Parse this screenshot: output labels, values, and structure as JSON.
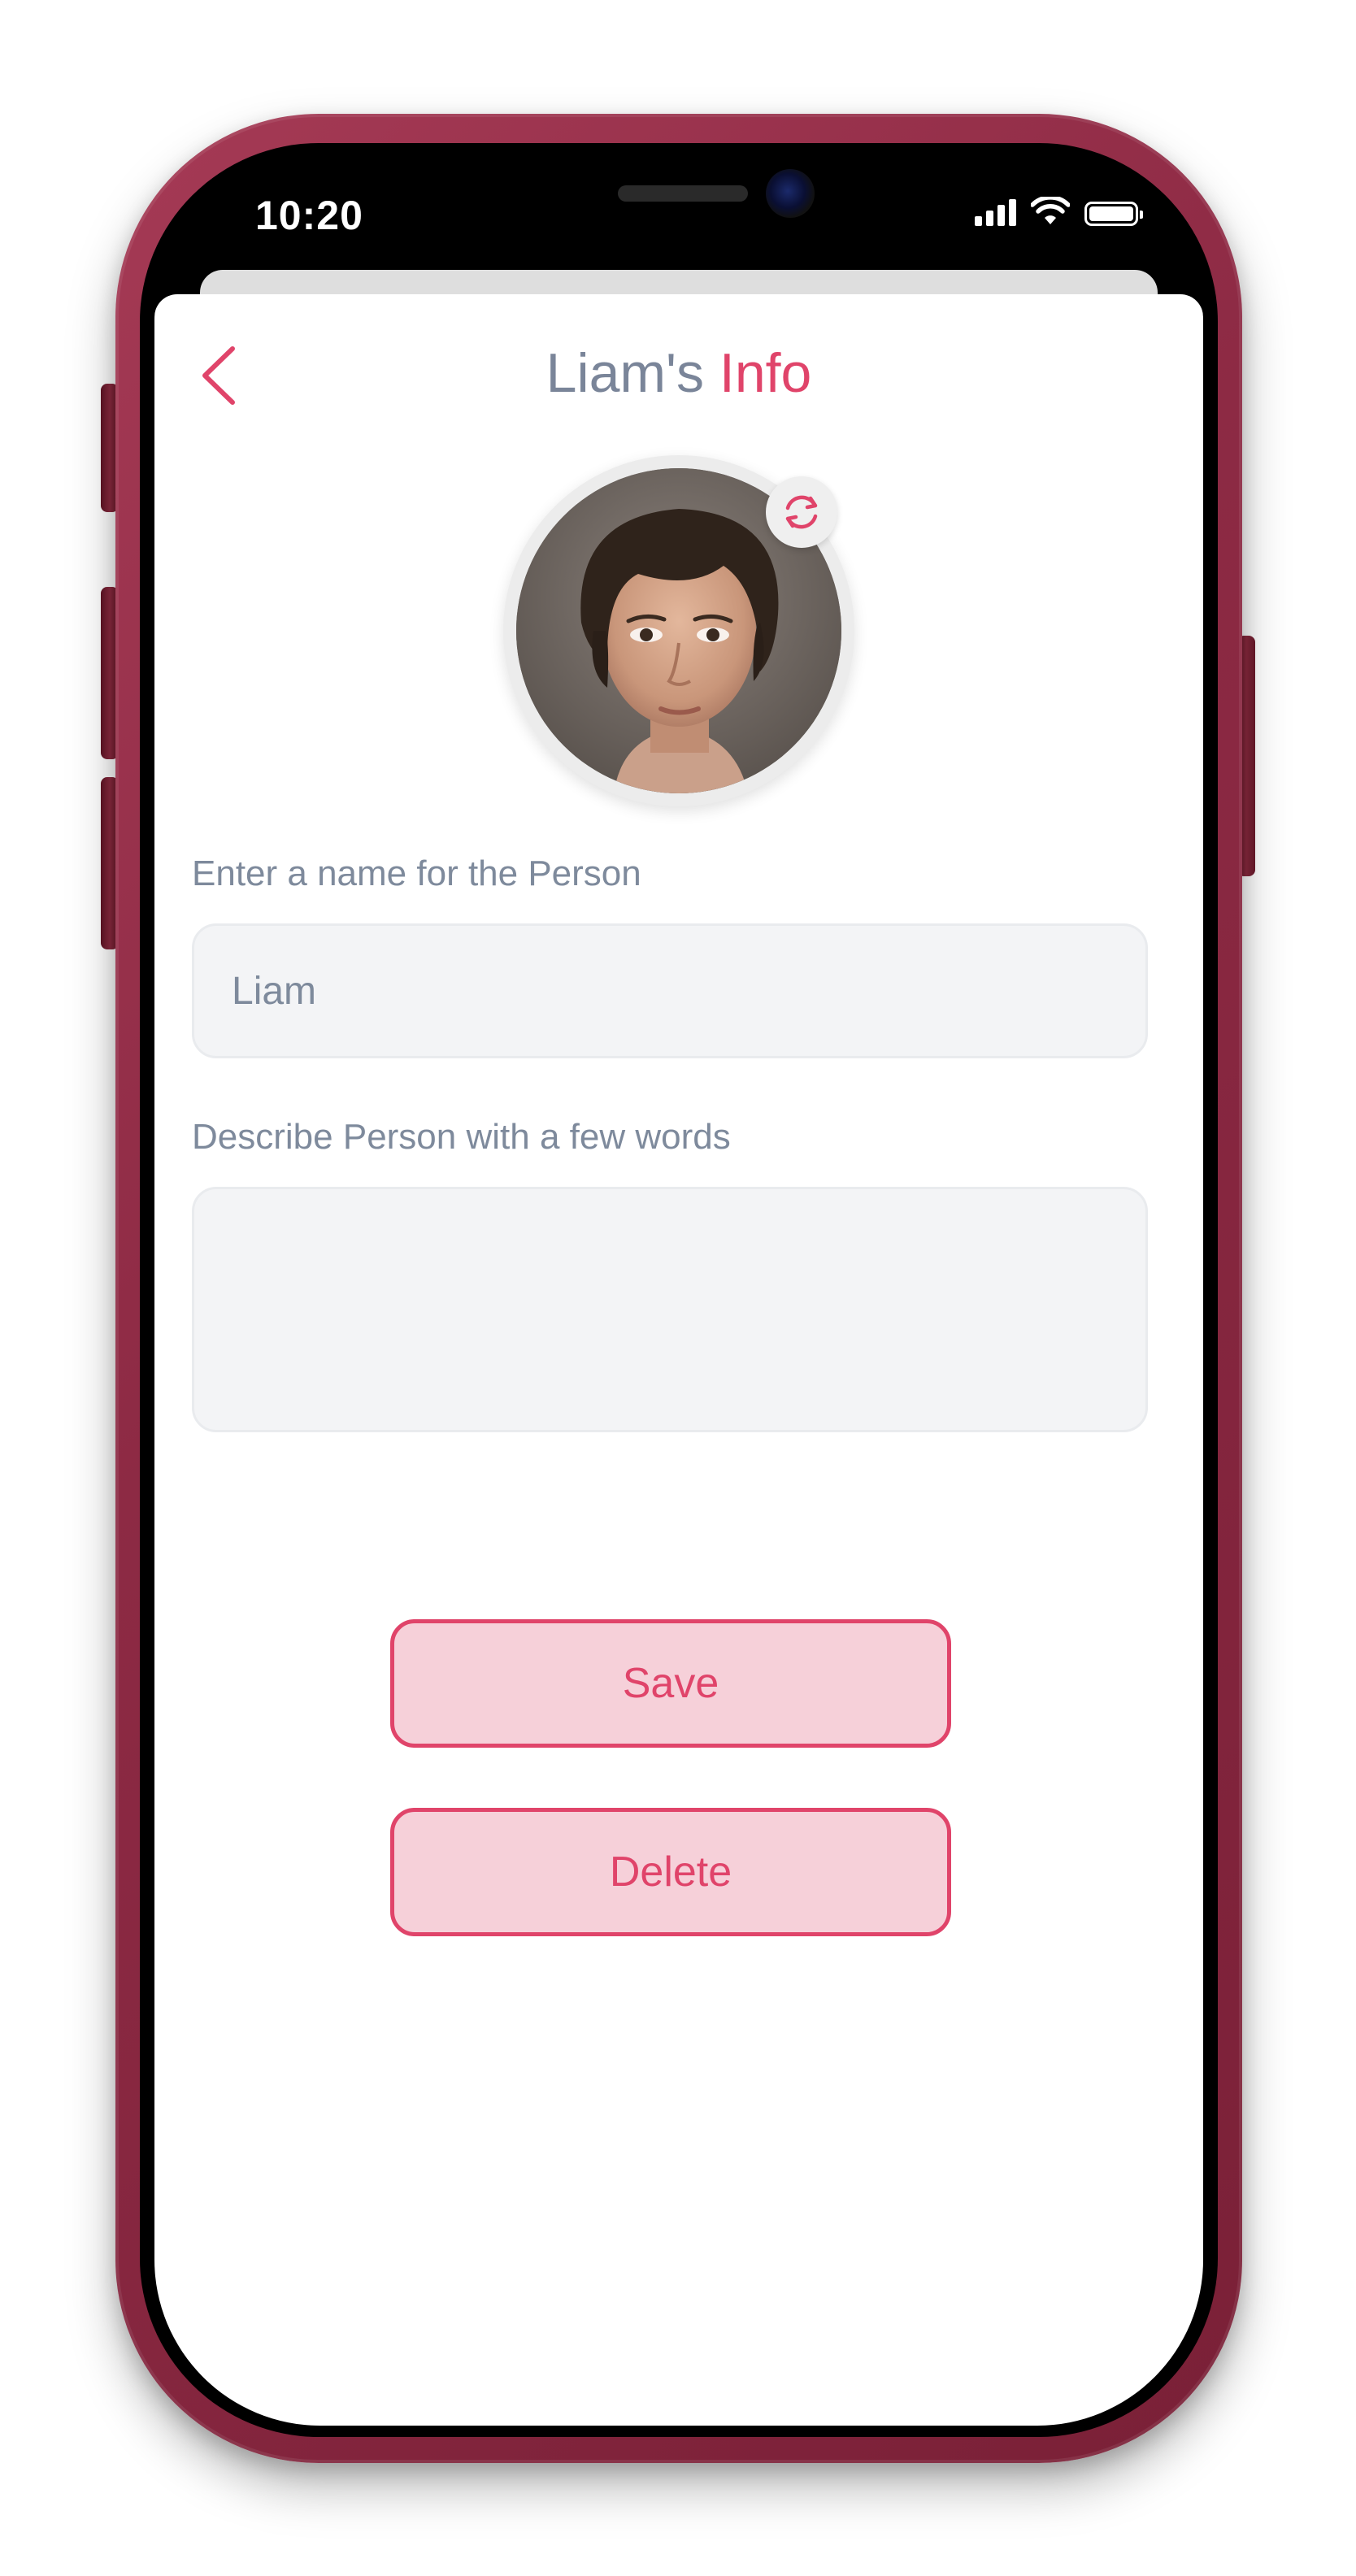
{
  "status_bar": {
    "time": "10:20"
  },
  "header": {
    "title_name": "Liam's",
    "title_accent": "Info"
  },
  "form": {
    "name_label": "Enter a name for the Person",
    "name_value": "Liam",
    "description_label": "Describe Person with a few words",
    "description_value": ""
  },
  "actions": {
    "save_label": "Save",
    "delete_label": "Delete"
  },
  "icons": {
    "back": "chevron-left-icon",
    "refresh": "refresh-icon",
    "signal": "cellular-signal-icon",
    "wifi": "wifi-icon",
    "battery": "battery-icon"
  },
  "colors": {
    "accent": "#e0446a",
    "accent_light": "#f6d0d9",
    "text_muted": "#7e8a9c",
    "field_bg": "#f3f4f6",
    "frame": "#8d2a44"
  }
}
